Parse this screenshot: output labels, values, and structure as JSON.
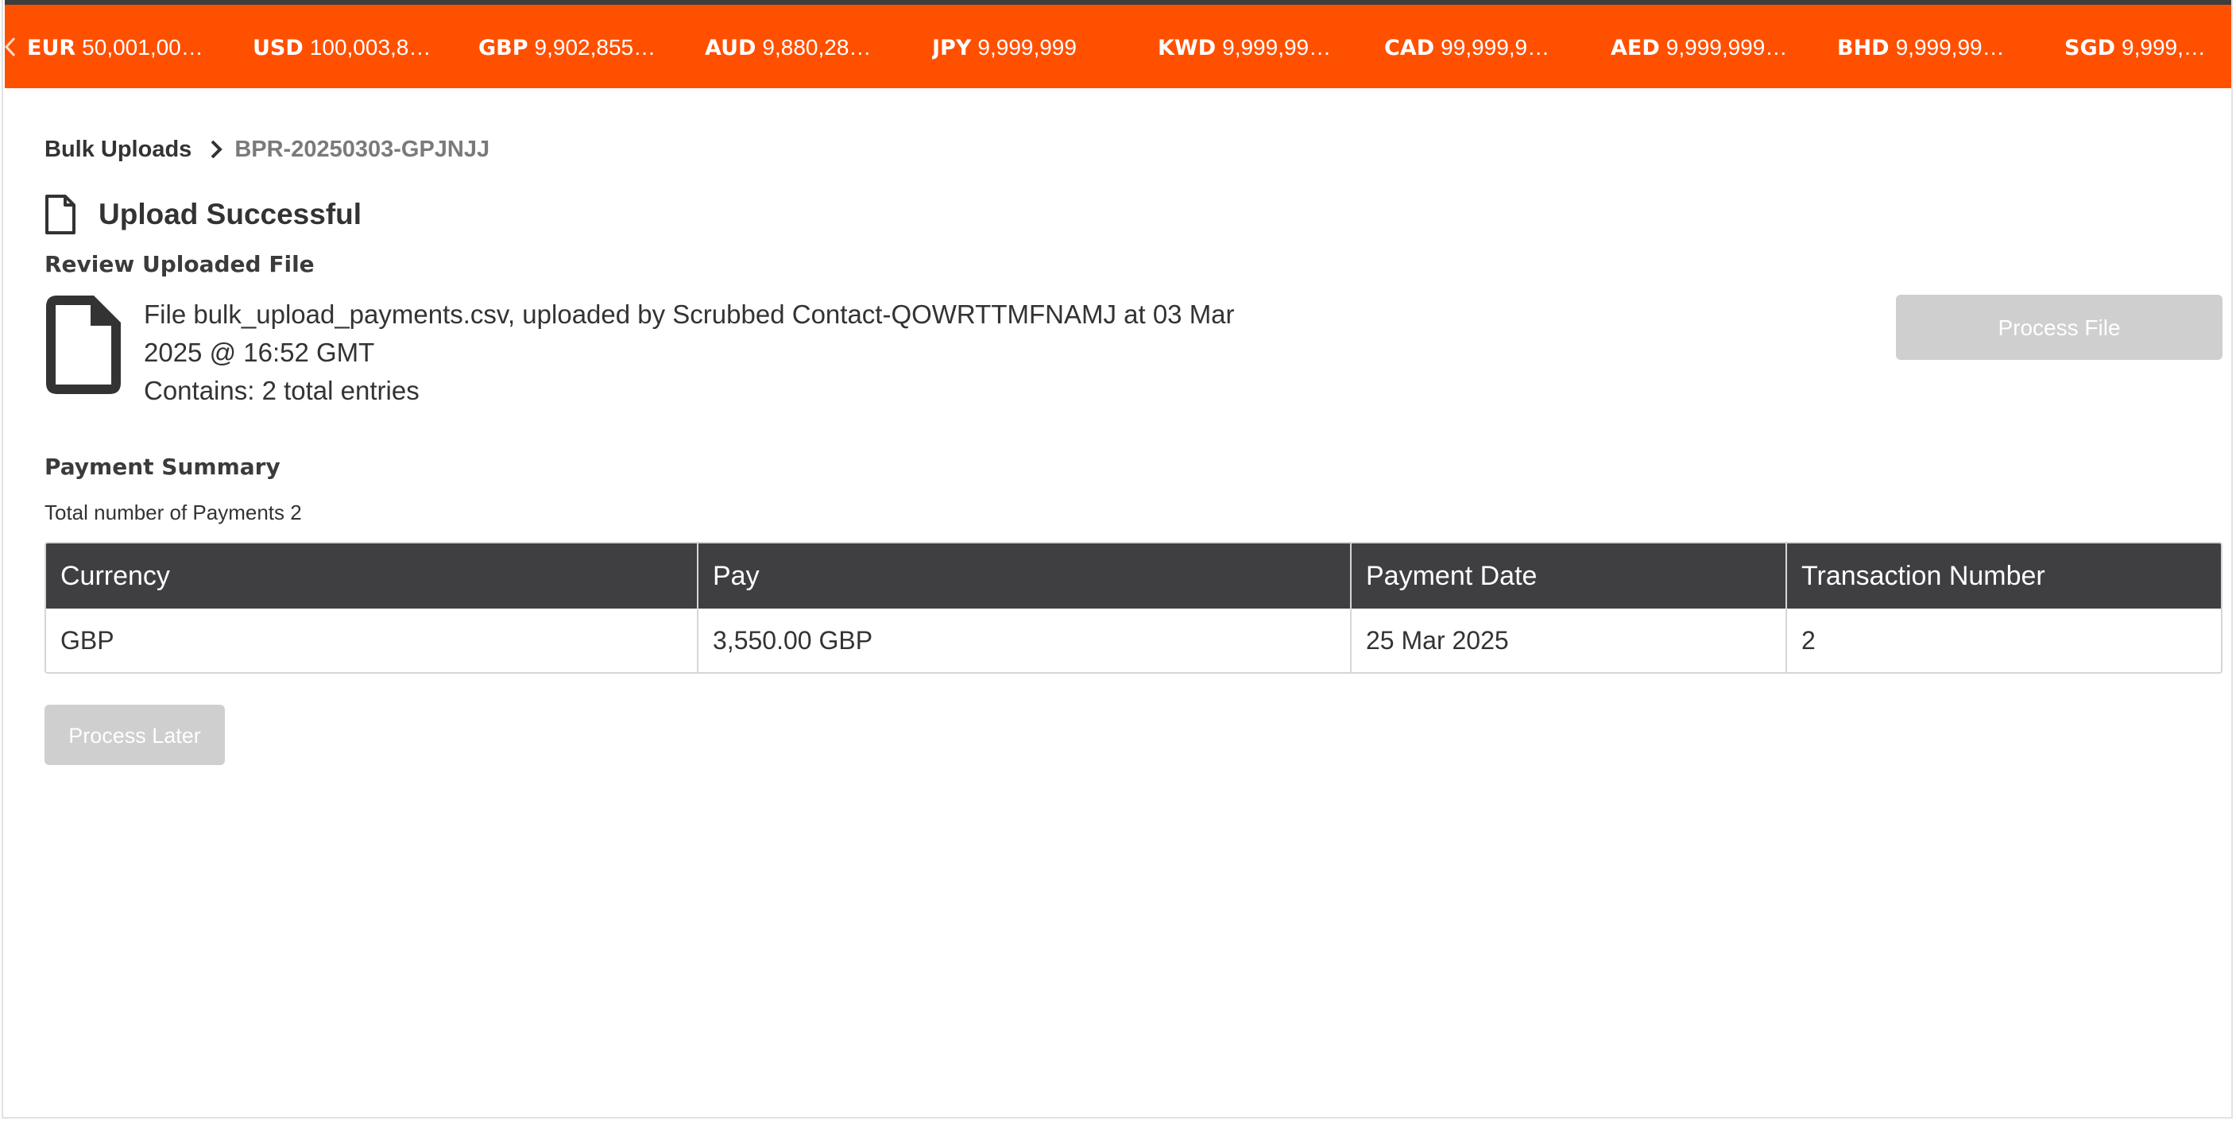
{
  "ticker": {
    "items": [
      {
        "code": "EUR",
        "value": "50,001,00…"
      },
      {
        "code": "USD",
        "value": "100,003,8…"
      },
      {
        "code": "GBP",
        "value": "9,902,855…"
      },
      {
        "code": "AUD",
        "value": "9,880,28…"
      },
      {
        "code": "JPY",
        "value": "9,999,999"
      },
      {
        "code": "KWD",
        "value": "9,999,99…"
      },
      {
        "code": "CAD",
        "value": "99,999,9…"
      },
      {
        "code": "AED",
        "value": "9,999,999…"
      },
      {
        "code": "BHD",
        "value": "9,999,99…"
      },
      {
        "code": "SGD",
        "value": "9,999,…"
      }
    ],
    "prev_icon": "chevron-left-icon",
    "background_color": "#ff5000"
  },
  "breadcrumb": {
    "root": "Bulk Uploads",
    "current": "BPR-20250303-GPJNJJ",
    "separator_icon": "chevron-right-icon"
  },
  "header": {
    "title": "Upload Successful",
    "icon": "file-outline-icon"
  },
  "review": {
    "heading": "Review Uploaded File",
    "icon": "file-icon",
    "line1": "File bulk_upload_payments.csv, uploaded by Scrubbed Contact-QOWRTTMFNAMJ at 03 Mar",
    "line2": "2025 @ 16:52 GMT",
    "line3": "Contains: 2 total entries",
    "process_file_label": "Process File"
  },
  "summary": {
    "heading": "Payment Summary",
    "total_label": "Total number of Payments 2",
    "columns": [
      "Currency",
      "Pay",
      "Payment Date",
      "Transaction Number"
    ],
    "rows": [
      [
        "GBP",
        "3,550.00 GBP",
        "25 Mar 2025",
        "2"
      ]
    ],
    "header_color": "#3f3f41"
  },
  "actions": {
    "process_later_label": "Process Later",
    "disabled_button_color": "#cfcfcf"
  }
}
